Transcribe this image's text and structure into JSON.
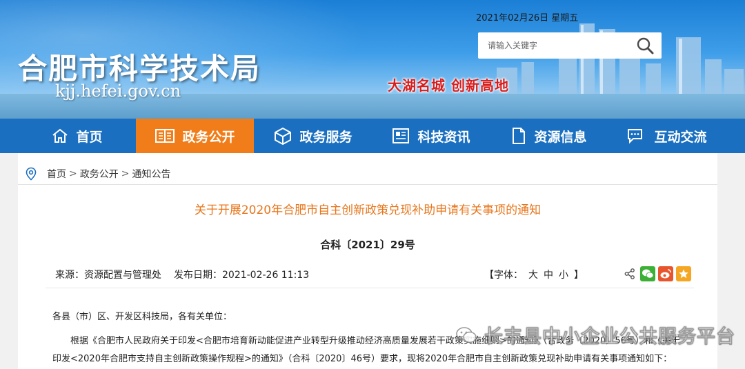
{
  "header": {
    "site_name": "合肥市科学技术局",
    "site_domain": "kjj.hefei.gov.cn",
    "date": "2021年02月26日 星期五",
    "search_placeholder": "请输入关键字",
    "slogan": "大湖名城 创新高地"
  },
  "nav": {
    "items": [
      {
        "label": "首页",
        "icon": "home-icon"
      },
      {
        "label": "政务公开",
        "icon": "book-icon",
        "active": true
      },
      {
        "label": "政务服务",
        "icon": "cube-icon"
      },
      {
        "label": "科技资讯",
        "icon": "news-icon"
      },
      {
        "label": "资源信息",
        "icon": "document-icon"
      },
      {
        "label": "互动交流",
        "icon": "chat-icon"
      }
    ]
  },
  "breadcrumb": {
    "items": [
      "首页",
      "政务公开",
      "通知公告"
    ],
    "separator": ">"
  },
  "article": {
    "title": "关于开展2020年合肥市自主创新政策兑现补助申请有关事项的通知",
    "number": "合科〔2021〕29号",
    "source": "来源：资源配置与管理处",
    "publish_date": "发布日期：2021-02-26 11:13",
    "font_ctrl": {
      "label": "【字体：",
      "large": "大",
      "medium": "中",
      "small": "小",
      "end": "】"
    },
    "salutation": "各县（市）区、开发区科技局，各有关单位：",
    "para1": "根据《合肥市人民政府关于印发<合肥市培育新动能促进产业转型升级推动经济高质量发展若干政策实施细则>的通知》（合政务〔2020〕56号）和《关于",
    "para2": "印发<2020年合肥市支持自主创新政策操作规程>的通知》（合科〔2020〕46号）要求，现将2020年合肥市自主创新政策兑现补助申请有关事项通知如下："
  },
  "share": {
    "icons": [
      "share-icon",
      "wechat-icon",
      "weibo-icon",
      "favorite-icon"
    ],
    "colors": {
      "wechat": "#3cb034",
      "weibo": "#e8552d",
      "favorite": "#f5a623"
    }
  },
  "watermark": {
    "text": "长丰县中小企业公共服务平台"
  },
  "colors": {
    "nav_bg": "#1a6fc0",
    "nav_active": "#f07d1a",
    "title": "#e8761b",
    "slogan": "#d91d1d"
  }
}
